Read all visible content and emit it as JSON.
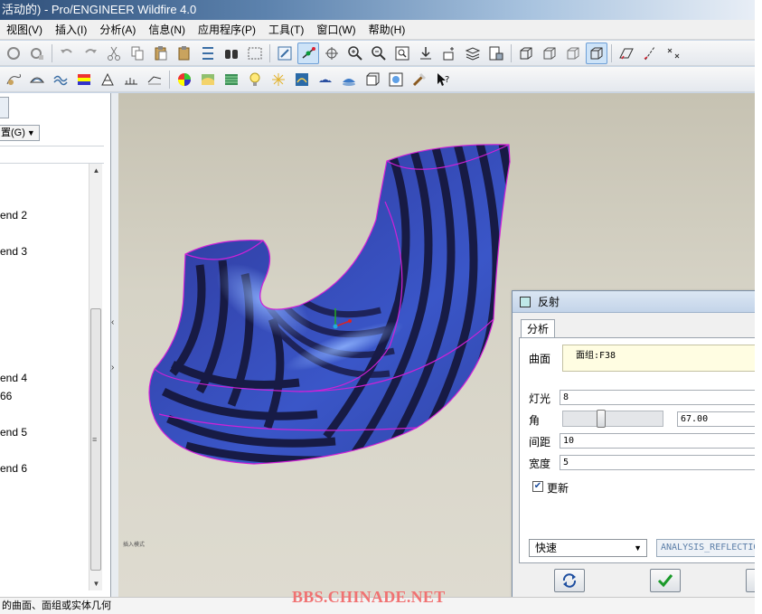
{
  "window": {
    "title": "活动的) - Pro/ENGINEER Wildfire 4.0"
  },
  "menu": [
    {
      "name": "menu-view",
      "label": "视图(V)"
    },
    {
      "name": "menu-insert",
      "label": "插入(I)"
    },
    {
      "name": "menu-analysis",
      "label": "分析(A)"
    },
    {
      "name": "menu-info",
      "label": "信息(N)"
    },
    {
      "name": "menu-applications",
      "label": "应用程序(P)"
    },
    {
      "name": "menu-tools",
      "label": "工具(T)"
    },
    {
      "name": "menu-window",
      "label": "窗口(W)"
    },
    {
      "name": "menu-help",
      "label": "帮助(H)"
    }
  ],
  "model_tree": {
    "settings_label": "置(G)",
    "items": [
      {
        "label": "end 2"
      },
      {
        "label": "end 3"
      },
      {
        "label": "end 4"
      },
      {
        "label": "66"
      },
      {
        "label": "end 5"
      },
      {
        "label": "end 6"
      }
    ]
  },
  "viewport": {
    "corner_label": "插入模式"
  },
  "dialog": {
    "title": "反射",
    "tab": "分析",
    "surface_label": "曲面",
    "surface_value": "面组:F38",
    "lights_label": "灯光",
    "lights_value": "8",
    "angle_label": "角",
    "angle_value": "67.00",
    "angle_fraction": 0.37,
    "spacing_label": "间距",
    "spacing_value": "10",
    "width_label": "宽度",
    "width_value": "5",
    "update_label": "更新",
    "update_checked": true,
    "mode_value": "快速",
    "result_name": "ANALYSIS_REFLECTION"
  },
  "status": {
    "text": "的曲面、面组或实体几何"
  },
  "watermark": "BBS.CHINADE.NET"
}
